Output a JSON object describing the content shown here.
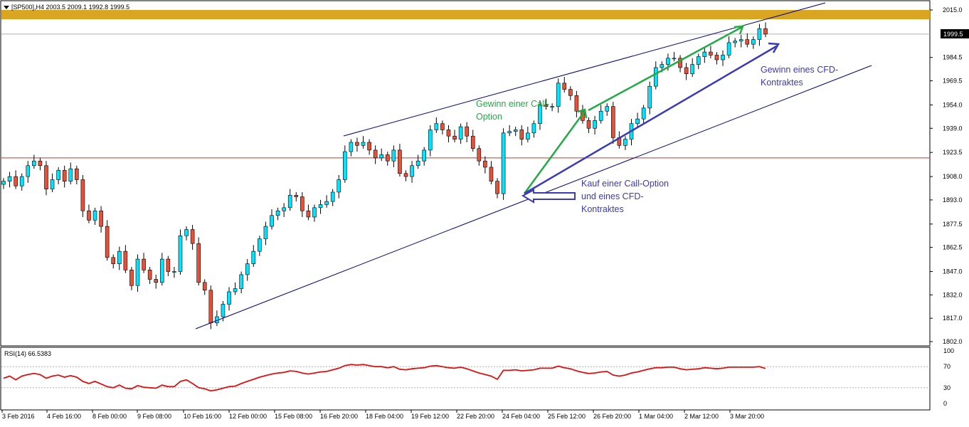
{
  "header": {
    "symbol_line": "[SP500],H4  2003.5 2009.1 1992.8 1999.5",
    "menu_icon": "triangle-down-icon"
  },
  "current_price_label": "1999.5",
  "colors": {
    "bull_body": "#00e5ff",
    "bear_body": "#e5523a",
    "wick": "#000000",
    "resistance_band": "#daa520",
    "support_line": "#c0392b",
    "channel": "#000080",
    "green_arrow": "#22aa44",
    "blue_arrow": "#3a3ab8",
    "rsi_line": "#dd1111"
  },
  "chart_data": [
    {
      "type": "candlestick",
      "title": "[SP500],H4",
      "ohlc_header": {
        "open": 2003.5,
        "high": 2009.1,
        "low": 1992.8,
        "close": 1999.5
      },
      "ylim": [
        1800,
        2020
      ],
      "y_ticks": [
        "2015.0",
        "1999.5",
        "1984.5",
        "1969.5",
        "1954.0",
        "1939.0",
        "1923.5",
        "1908.0",
        "1893.0",
        "1877.5",
        "1862.5",
        "1847.0",
        "1832.0",
        "1817.0",
        "1802.0"
      ],
      "x_ticks": [
        "3 Feb 2016",
        "4 Feb 16:00",
        "8 Feb 00:00",
        "9 Feb 08:00",
        "10 Feb 16:00",
        "12 Feb 00:00",
        "15 Feb 08:00",
        "16 Feb 20:00",
        "18 Feb 04:00",
        "19 Feb 12:00",
        "22 Feb 20:00",
        "24 Feb 04:00",
        "25 Feb 12:00",
        "26 Feb 20:00",
        "1 Mar 04:00",
        "2 Mar 12:00",
        "3 Mar 20:00"
      ],
      "close_path": [
        1905,
        1908,
        1902,
        1908,
        1915,
        1918,
        1915,
        1900,
        1906,
        1912,
        1905,
        1913,
        1906,
        1886,
        1880,
        1886,
        1876,
        1856,
        1852,
        1860,
        1848,
        1838,
        1855,
        1848,
        1842,
        1840,
        1855,
        1847,
        1847,
        1870,
        1874,
        1865,
        1840,
        1835,
        1814,
        1818,
        1826,
        1834,
        1836,
        1845,
        1852,
        1860,
        1868,
        1876,
        1883,
        1886,
        1888,
        1896,
        1895,
        1886,
        1882,
        1888,
        1890,
        1892,
        1898,
        1906,
        1924,
        1930,
        1928,
        1930,
        1925,
        1920,
        1922,
        1918,
        1925,
        1910,
        1908,
        1915,
        1918,
        1925,
        1938,
        1942,
        1938,
        1934,
        1932,
        1940,
        1934,
        1926,
        1918,
        1914,
        1905,
        1897,
        1936,
        1937,
        1938,
        1932,
        1936,
        1942,
        1954,
        1953,
        1953,
        1968,
        1964,
        1960,
        1950,
        1944,
        1939,
        1944,
        1950,
        1953,
        1933,
        1928,
        1932,
        1942,
        1945,
        1952,
        1966,
        1978,
        1980,
        1984,
        1984,
        1978,
        1974,
        1980,
        1985,
        1988,
        1986,
        1983,
        1986,
        1994,
        1995,
        1996,
        1993,
        1996,
        2003,
        1999.5
      ],
      "resistance_zone": [
        2009,
        2015
      ],
      "current_price": 1999.5,
      "horizontal_level": 1920,
      "annotations": [
        "Gewinn einer Call-Option",
        "Kauf einer Call-Option und eines CFD-Kontraktes",
        "Gewinn eines CFD-Kontraktes"
      ]
    },
    {
      "type": "line",
      "title": "RSI(14) 66.5383",
      "ylim": [
        0,
        100
      ],
      "y_ticks": [
        "100",
        "70",
        "30",
        "0"
      ],
      "levels": [
        70,
        30
      ],
      "values": [
        48,
        52,
        45,
        52,
        55,
        57,
        55,
        48,
        52,
        54,
        50,
        53,
        50,
        42,
        38,
        42,
        37,
        32,
        30,
        35,
        29,
        28,
        34,
        31,
        30,
        29,
        35,
        32,
        32,
        42,
        45,
        38,
        30,
        28,
        24,
        26,
        29,
        32,
        33,
        38,
        42,
        46,
        50,
        53,
        56,
        58,
        59,
        62,
        61,
        58,
        56,
        58,
        60,
        61,
        64,
        67,
        72,
        74,
        73,
        74,
        72,
        70,
        70,
        68,
        70,
        65,
        64,
        66,
        67,
        68,
        71,
        72,
        70,
        68,
        67,
        69,
        66,
        62,
        58,
        55,
        52,
        46,
        63,
        63,
        64,
        62,
        63,
        64,
        67,
        67,
        67,
        71,
        68,
        66,
        62,
        59,
        57,
        58,
        60,
        61,
        54,
        52,
        54,
        58,
        60,
        63,
        66,
        68,
        68,
        69,
        69,
        66,
        64,
        65,
        66,
        68,
        67,
        66,
        67,
        69,
        69,
        69,
        69,
        69,
        70,
        66.5
      ]
    }
  ],
  "annotations": {
    "call_gain": "Gewinn einer Call-Option",
    "entry": "Kauf einer Call-Option und eines CFD-Kontraktes",
    "cfd_gain": "Gewinn eines CFD-Kontraktes"
  },
  "rsi_panel": {
    "label": "RSI(14) 66.5383"
  }
}
